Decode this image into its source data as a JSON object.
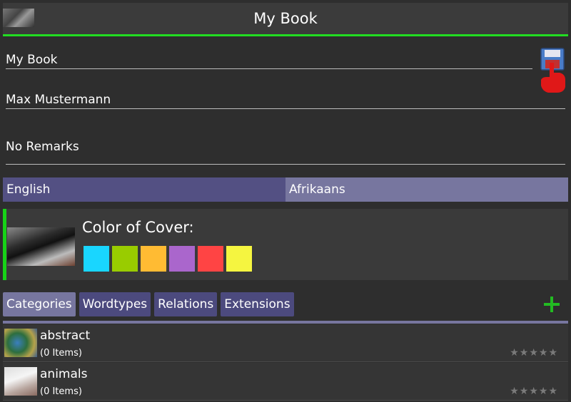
{
  "header": {
    "title": "My Book",
    "thumbnail_icon": "darth-vader-thumbnail"
  },
  "form": {
    "book_title": "My Book",
    "author": "Max Mustermann",
    "remarks": "No Remarks",
    "save_icon": "floppy-disk-save-icon",
    "pointer_icon": "pointing-hand-icon"
  },
  "languages": {
    "source": "English",
    "target": "Afrikaans"
  },
  "cover": {
    "label": "Color of Cover:",
    "colors": [
      "#19d6ff",
      "#99cc00",
      "#ffbb33",
      "#aa66cc",
      "#ff4444",
      "#f5f540"
    ]
  },
  "tabs": [
    {
      "label": "Categories",
      "active": true
    },
    {
      "label": "Wordtypes",
      "active": false
    },
    {
      "label": "Relations",
      "active": false
    },
    {
      "label": "Extensions",
      "active": false
    }
  ],
  "add_icon": "plus-icon",
  "categories": [
    {
      "name": "abstract",
      "count": "(0 Items)",
      "stars": "★★★★★",
      "rating": 0
    },
    {
      "name": "animals",
      "count": "(0 Items)",
      "stars": "★★★★★",
      "rating": 0
    }
  ],
  "colors": {
    "accent_green": "#22dd22",
    "tab_bg": "#4c4a7e",
    "tab_active": "#77769f"
  }
}
